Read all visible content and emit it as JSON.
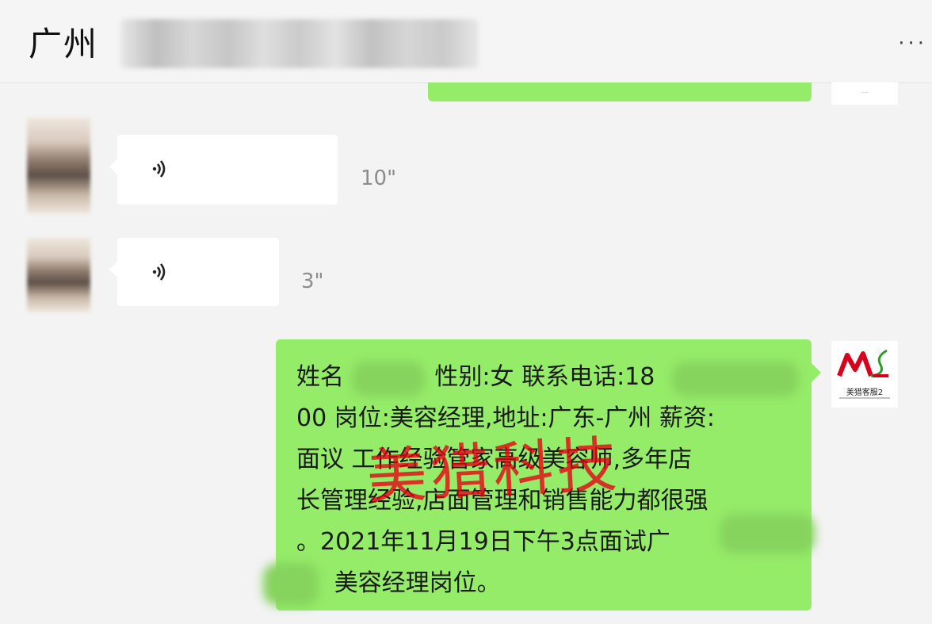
{
  "header": {
    "title": "广州",
    "more_icon": "more-dots-icon"
  },
  "messages": [
    {
      "type": "voice",
      "direction": "incoming",
      "duration": "10\""
    },
    {
      "type": "voice",
      "direction": "incoming",
      "duration": "3\""
    },
    {
      "type": "text",
      "direction": "outgoing",
      "text": "姓名            性别:女 联系电话:18\n00 岗位:美容经理,地址:广东-广州 薪资:\n面议 工作经验管家高级美容师,多年店\n长管理经验,店面管理和销售能力都很强\n。2021年11月19日下午3点面试广\n     美容经理岗位。"
    }
  ],
  "watermark": "美猎科技",
  "logo": {
    "name": "美猎客服2"
  },
  "colors": {
    "bubble_green": "#95ec69",
    "background": "#f3f3f3",
    "watermark_red": "#e60012"
  }
}
